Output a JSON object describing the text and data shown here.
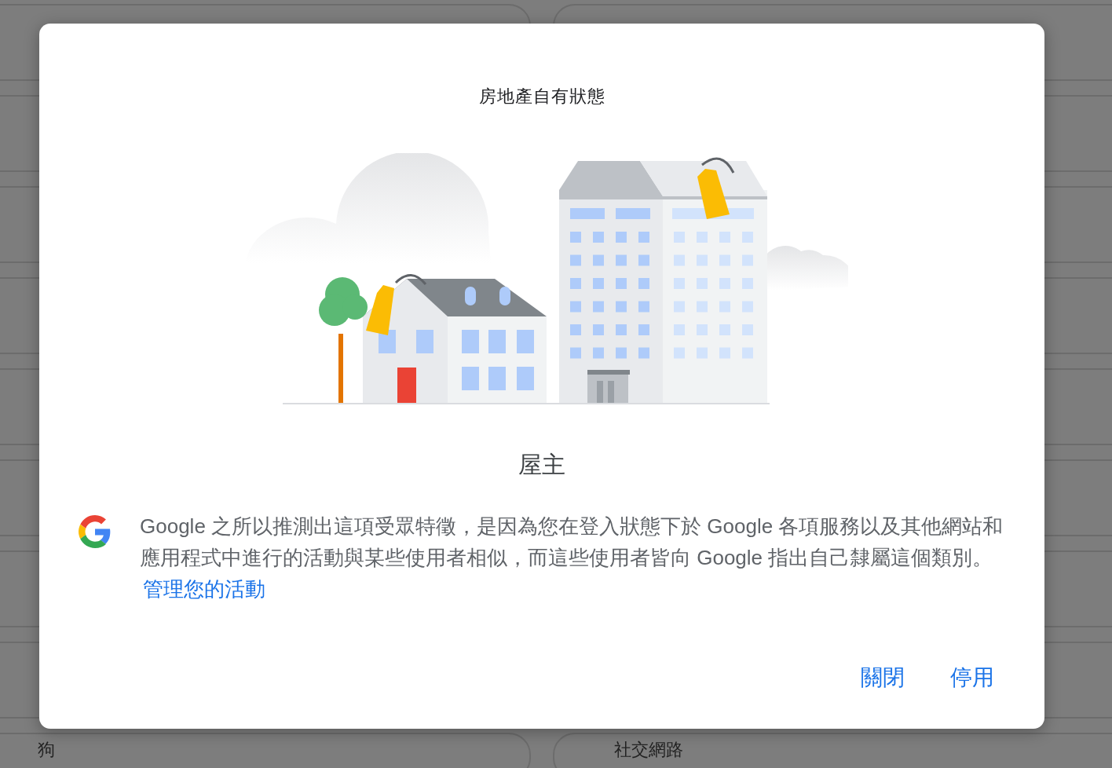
{
  "background_items": [
    {
      "label": "狗"
    },
    {
      "label": "社交網路"
    }
  ],
  "dialog": {
    "title": "房地產自有狀態",
    "segment": "屋主",
    "description": "Google 之所以推測出這項受眾特徵，是因為您在登入狀態下於 Google 各項服務以及其他網站和應用程式中進行的活動與某些使用者相似，而這些使用者皆向 Google 指出自己隸屬這個類別。",
    "link": "管理您的活動",
    "buttons": [
      {
        "label": "關閉"
      },
      {
        "label": "停用"
      }
    ]
  }
}
